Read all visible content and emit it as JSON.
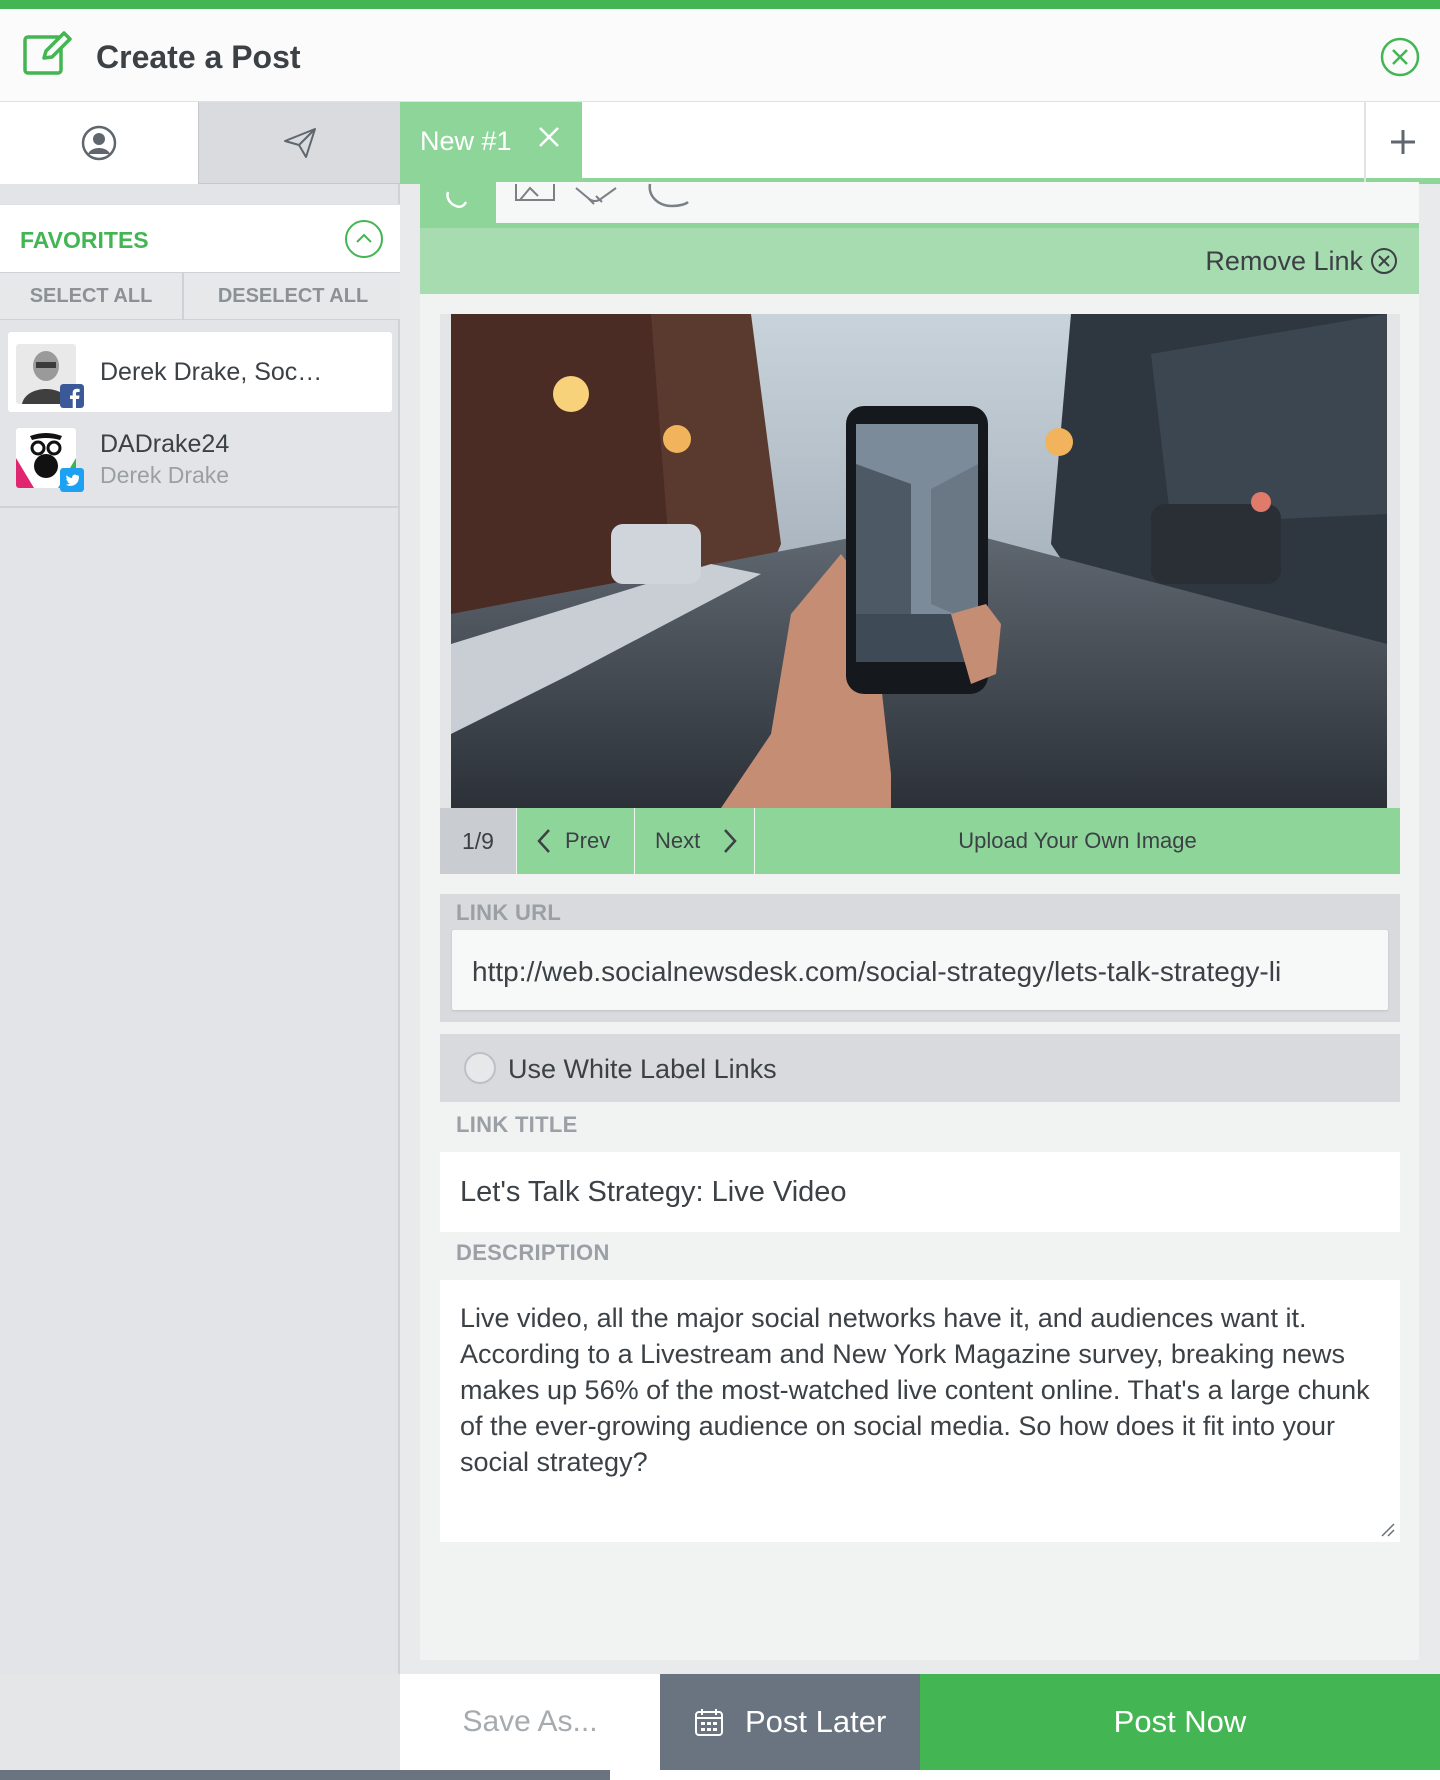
{
  "header": {
    "title": "Create a Post"
  },
  "left": {
    "favorites_label": "FAVORITES",
    "select_all": "SELECT ALL",
    "deselect_all": "DESELECT ALL",
    "accounts": [
      {
        "name": "Derek Drake, Soc…",
        "network": "facebook"
      },
      {
        "name": "DADrake24",
        "subtitle": "Derek Drake",
        "network": "twitter"
      }
    ]
  },
  "tabs": {
    "active_label": "New #1"
  },
  "link": {
    "remove_label": "Remove Link",
    "image_counter": "1/9",
    "prev_label": "Prev",
    "next_label": "Next",
    "upload_label": "Upload Your Own Image",
    "url_label": "LINK URL",
    "url_value": "http://web.socialnewsdesk.com/social-strategy/lets-talk-strategy-li",
    "white_label": "Use White Label Links",
    "title_label": "LINK TITLE",
    "title_value": "Let's Talk Strategy: Live Video",
    "description_label": "DESCRIPTION",
    "description_value": "Live video, all the major social networks have it, and audiences want it. According to a Livestream and New York Magazine survey, breaking news makes up 56% of the most-watched live content online. That's a large chunk of the ever-growing audience on social media. So how does it fit into your social strategy?"
  },
  "footer": {
    "save_label": "Save As...",
    "later_label": "Post Later",
    "now_label": "Post Now"
  },
  "colors": {
    "accent": "#43b653",
    "accent_light": "#8ed59a",
    "slate": "#6a7480"
  }
}
